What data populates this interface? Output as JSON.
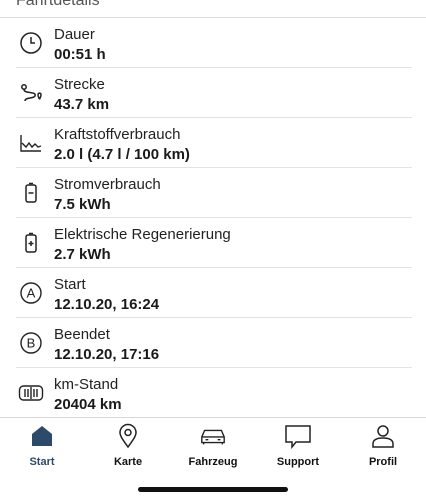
{
  "section": {
    "title": "Fahrtdetails"
  },
  "rows": [
    {
      "icon": "clock-icon",
      "label": "Dauer",
      "value": "00:51 h"
    },
    {
      "icon": "route-icon",
      "label": "Strecke",
      "value": "43.7 km"
    },
    {
      "icon": "fuel-graph-icon",
      "label": "Kraftstoffverbrauch",
      "value": "2.0 l (4.7 l / 100 km)"
    },
    {
      "icon": "battery-icon",
      "label": "Stromverbrauch",
      "value": "7.5 kWh"
    },
    {
      "icon": "battery-charge-icon",
      "label": "Elektrische Regenerierung",
      "value": "2.7 kWh"
    },
    {
      "icon": "start-a-icon",
      "label": "Start",
      "value": "12.10.20, 16:24"
    },
    {
      "icon": "end-b-icon",
      "label": "Beendet",
      "value": "12.10.20, 17:16"
    },
    {
      "icon": "odometer-icon",
      "label": "km-Stand",
      "value": "20404 km"
    }
  ],
  "icon_letters": {
    "start": "A",
    "end": "B"
  },
  "tabs": [
    {
      "id": "start",
      "icon": "home-icon",
      "label": "Start",
      "active": true
    },
    {
      "id": "karte",
      "icon": "map-pin-icon",
      "label": "Karte",
      "active": false
    },
    {
      "id": "fahrzeug",
      "icon": "car-icon",
      "label": "Fahrzeug",
      "active": false
    },
    {
      "id": "support",
      "icon": "chat-icon",
      "label": "Support",
      "active": false
    },
    {
      "id": "profil",
      "icon": "person-icon",
      "label": "Profil",
      "active": false
    }
  ],
  "colors": {
    "accent": "#2d4a6b",
    "divider": "#e3e3e3",
    "text": "#1b1b1b"
  }
}
